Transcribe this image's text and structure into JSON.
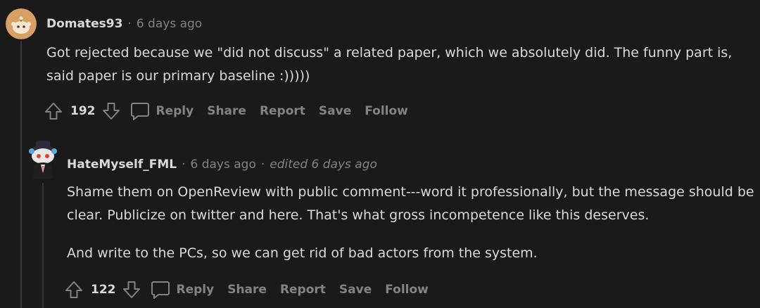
{
  "comments": [
    {
      "author": "Domates93",
      "time": "6 days ago",
      "edited": "",
      "body": [
        "Got rejected because we \"did not discuss\" a related paper, which we absolutely did. The funny part is, said paper is our primary baseline :)))))"
      ],
      "votes": "192",
      "avatar_color": "#d9a066"
    },
    {
      "author": "HateMyself_FML",
      "time": "6 days ago",
      "edited": "edited 6 days ago",
      "body": [
        "Shame them on OpenReview with public comment---word it professionally, but the message should be clear. Publicize on twitter and here. That's what gross incompetence like this deserves.",
        "And write to the PCs, so we can get rid of bad actors from the system."
      ],
      "votes": "122",
      "avatar_color": "#e8e8e8"
    }
  ],
  "actions": {
    "reply": "Reply",
    "share": "Share",
    "report": "Report",
    "save": "Save",
    "follow": "Follow"
  },
  "separator": "·",
  "colors": {
    "background": "#1a1a1b",
    "text": "#d7dadc",
    "muted": "#818384",
    "thread_line": "#343536"
  }
}
